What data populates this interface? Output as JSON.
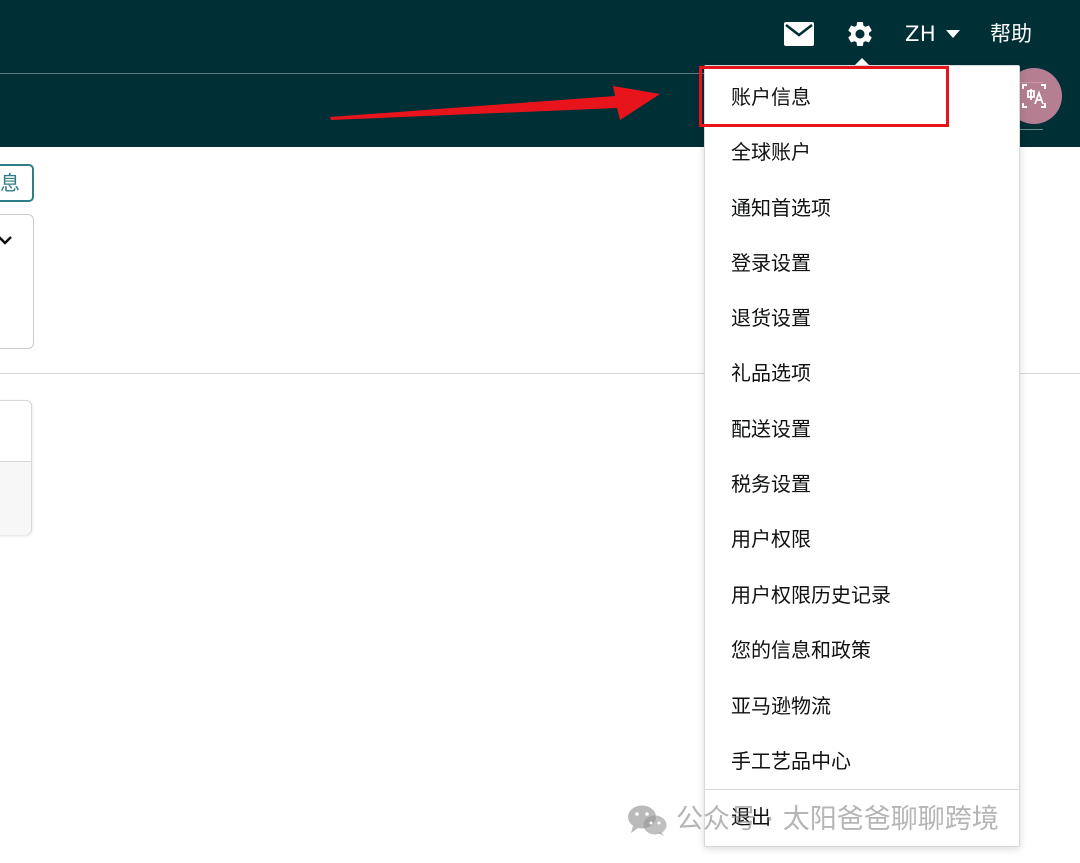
{
  "header": {
    "language": "ZH",
    "help_label": "帮助"
  },
  "left_panel": {
    "info_button_label": "息"
  },
  "settings_menu": {
    "items": [
      "账户信息",
      "全球账户",
      "通知首选项",
      "登录设置",
      "退货设置",
      "礼品选项",
      "配送设置",
      "税务设置",
      "用户权限",
      "用户权限历史记录",
      "您的信息和政策",
      "亚马逊物流",
      "手工艺品中心"
    ],
    "logout_label": "退出",
    "highlighted_item": "账户信息"
  },
  "watermark": {
    "text": "公众号 · 太阳爸爸聊聊跨境"
  },
  "colors": {
    "header_bg": "#002f36",
    "annotation_red": "#e8141c",
    "accent_teal": "#2f7d86"
  },
  "icons": [
    "mail-icon",
    "gear-icon",
    "caret-down-icon",
    "translate-icon",
    "chevron-down-icon",
    "wechat-icon"
  ]
}
